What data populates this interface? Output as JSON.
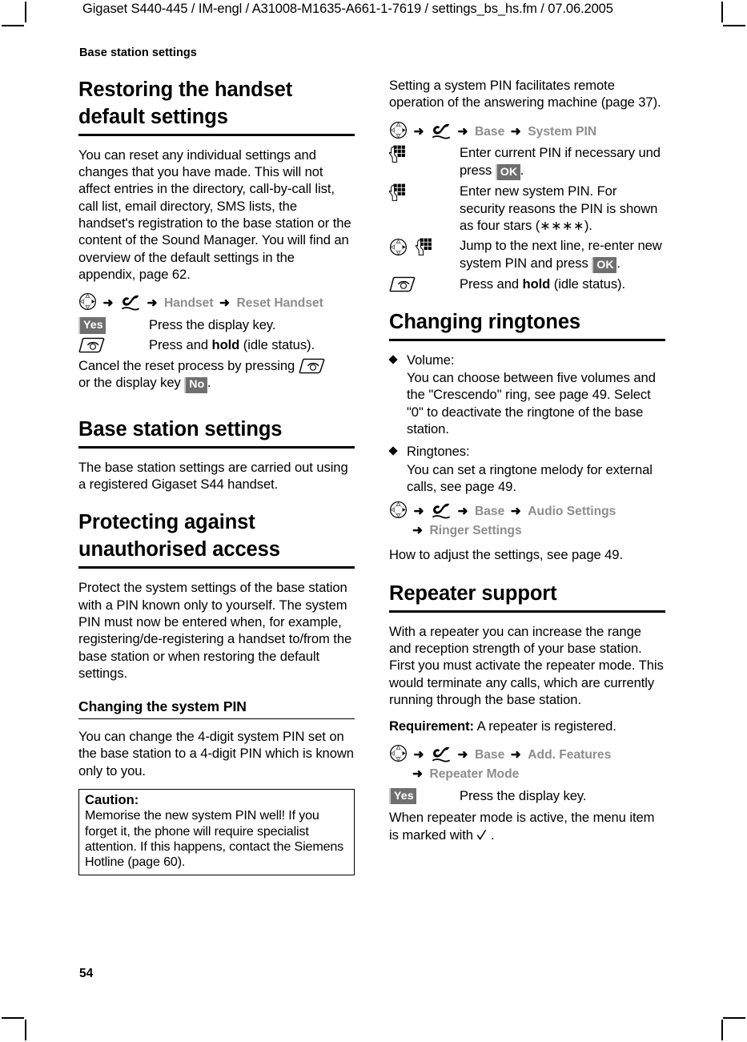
{
  "document": {
    "header_line": "Gigaset S440-445 / IM-engl / A31008-M1635-A661-1-7619 / settings_bs_hs.fm / 07.06.2005",
    "running_head": "Base station settings",
    "page_number": "54"
  },
  "icons": {
    "nav_key": "navigation-key-icon",
    "settings_tool": "settings-tool-icon",
    "hangup_key": "hangup-key-icon",
    "keypad": "keypad-digit-icon",
    "checkmark": "checkmark-icon",
    "arrow": "➜",
    "bullet": "◆"
  },
  "left_column": {
    "heading_1": "Restoring the handset default settings",
    "para_1": "You can reset any individual settings and changes that you have made. This will not affect entries in the directory, call-by-call list, call list, email directory, SMS lists, the handset's registration to the base station or the content of the Sound Manager. You will find an overview of the default settings in the appendix, page 62.",
    "menu_path_1": [
      "Handset",
      "Reset Handset"
    ],
    "step_1": {
      "key": "Yes",
      "text": "Press the display key."
    },
    "step_2": {
      "text_before": "Press and ",
      "bold": "hold",
      "text_after": " (idle status)."
    },
    "cancel_text_a": "Cancel the reset process by pressing",
    "cancel_text_b": "or the display key",
    "cancel_key": "No",
    "cancel_text_c": ".",
    "heading_2": "Base station settings",
    "para_2": "The base station settings are carried out using a registered Gigaset S44 handset.",
    "heading_3": "Protecting against unauthorised access",
    "para_3": "Protect the system settings of the base station with a PIN known only to yourself. The system PIN must now be entered when, for example, registering/de-registering a handset to/from the base station or when restoring the default settings.",
    "heading_4": "Changing the system PIN",
    "para_4": "You can change the 4-digit system PIN set on the base station to a 4-digit PIN which is known only to you.",
    "caution": {
      "title": "Caution:",
      "body": "Memorise the new system PIN well! If you forget it, the phone will require specialist attention. If this happens, contact the Siemens Hotline (page 60)."
    }
  },
  "right_column": {
    "para_1": "Setting a system PIN facilitates remote operation of the answering machine (page 37).",
    "menu_path_1": [
      "Base",
      "System PIN"
    ],
    "step_1": {
      "text_before": "Enter current PIN if necessary und press ",
      "key": "OK",
      "text_after": "."
    },
    "step_2": {
      "text": "Enter new system PIN. For security reasons the PIN is shown as four stars (",
      "stars": "∗∗∗∗",
      "text_after": ")."
    },
    "step_3": {
      "text_before": "Jump to the next line, re-enter new system PIN and press ",
      "key": "OK",
      "text_after": "."
    },
    "step_4": {
      "text_before": "Press and ",
      "bold": "hold",
      "text_after": " (idle status)."
    },
    "heading_1": "Changing ringtones",
    "bullets": [
      {
        "label": "Volume:",
        "text": "You can choose between five volumes and the \"Crescendo\" ring, see page 49. Select \"0\" to deactivate the ringtone of the base station."
      },
      {
        "label": "Ringtones:",
        "text": "You can set a ringtone melody for external calls, see page 49."
      }
    ],
    "menu_path_2": [
      "Base",
      "Audio Settings"
    ],
    "menu_path_2_indent": "Ringer Settings",
    "para_2": "How to adjust the settings, see page 49.",
    "heading_2": "Repeater support",
    "para_3": "With a repeater you can increase the range and reception strength of your base station. First you must activate the repeater mode. This would terminate any calls, which are currently running through the base station.",
    "requirement_label": "Requirement:",
    "requirement_text": " A repeater is registered.",
    "menu_path_3": [
      "Base",
      "Add. Features"
    ],
    "menu_path_3_indent": "Repeater Mode",
    "step_5": {
      "key": "Yes",
      "text": "Press the display key."
    },
    "para_4_before": "When repeater mode is active, the menu item is marked with",
    "para_4_after": "."
  }
}
